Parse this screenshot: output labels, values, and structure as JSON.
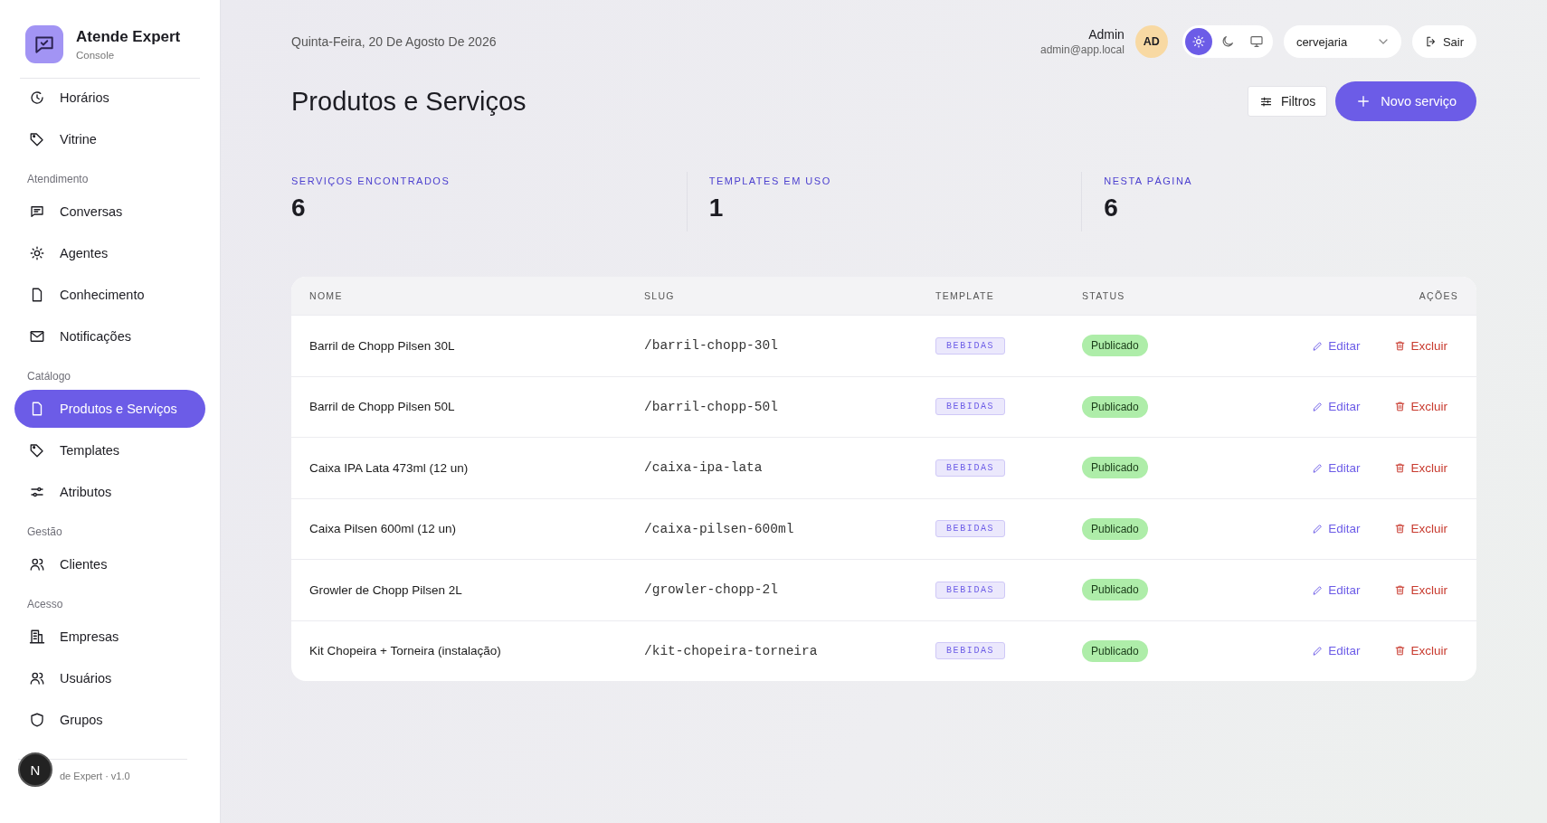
{
  "sidebar": {
    "brand": {
      "title": "Atende Expert",
      "subtitle": "Console"
    },
    "sections": [
      {
        "items": [
          {
            "label": "Horários",
            "selected": false
          },
          {
            "label": "Vitrine",
            "selected": false
          }
        ]
      },
      {
        "title": "Atendimento",
        "items": [
          {
            "label": "Conversas",
            "selected": false
          },
          {
            "label": "Agentes",
            "selected": false
          },
          {
            "label": "Conhecimento",
            "selected": false
          },
          {
            "label": "Notificações",
            "selected": false
          }
        ]
      },
      {
        "title": "Catálogo",
        "items": [
          {
            "label": "Produtos e Serviços",
            "selected": true
          },
          {
            "label": "Templates",
            "selected": false
          },
          {
            "label": "Atributos",
            "selected": false
          }
        ]
      },
      {
        "title": "Gestão",
        "items": [
          {
            "label": "Clientes",
            "selected": false
          }
        ]
      },
      {
        "title": "Acesso",
        "items": [
          {
            "label": "Empresas",
            "selected": false
          },
          {
            "label": "Usuários",
            "selected": false
          },
          {
            "label": "Grupos",
            "selected": false
          }
        ]
      }
    ],
    "footer": "de Expert · v1.0",
    "dev_badge": "N"
  },
  "header": {
    "date": "Quinta-Feira, 20 De Agosto De 2026",
    "user": {
      "name": "Admin",
      "email": "admin@app.local",
      "initials": "AD"
    },
    "theme_options": [
      {
        "selected": true
      },
      {
        "selected": false
      },
      {
        "selected": false
      }
    ],
    "company_select": {
      "value": "cervejaria"
    },
    "logout": "Sair"
  },
  "page": {
    "title": "Produtos e Serviços",
    "filter_button": "Filtros",
    "new_button": "Novo serviço"
  },
  "stats": [
    {
      "label": "SERVIÇOS ENCONTRADOS",
      "value": "6"
    },
    {
      "label": "TEMPLATES EM USO",
      "value": "1"
    },
    {
      "label": "NESTA PÁGINA",
      "value": "6"
    }
  ],
  "table": {
    "columns": [
      "NOME",
      "SLUG",
      "TEMPLATE",
      "STATUS",
      "AÇÕES"
    ],
    "rows": [
      {
        "name": "Barril de Chopp Pilsen 30L",
        "slug": "/barril-chopp-30l",
        "template": "BEBIDAS",
        "status": "Publicado",
        "edit": "Editar",
        "delete": "Excluir"
      },
      {
        "name": "Barril de Chopp Pilsen 50L",
        "slug": "/barril-chopp-50l",
        "template": "BEBIDAS",
        "status": "Publicado",
        "edit": "Editar",
        "delete": "Excluir"
      },
      {
        "name": "Caixa IPA Lata 473ml (12 un)",
        "slug": "/caixa-ipa-lata",
        "template": "BEBIDAS",
        "status": "Publicado",
        "edit": "Editar",
        "delete": "Excluir"
      },
      {
        "name": "Caixa Pilsen 600ml (12 un)",
        "slug": "/caixa-pilsen-600ml",
        "template": "BEBIDAS",
        "status": "Publicado",
        "edit": "Editar",
        "delete": "Excluir"
      },
      {
        "name": "Growler de Chopp Pilsen 2L",
        "slug": "/growler-chopp-2l",
        "template": "BEBIDAS",
        "status": "Publicado",
        "edit": "Editar",
        "delete": "Excluir"
      },
      {
        "name": "Kit Chopeira + Torneira (instalação)",
        "slug": "/kit-chopeira-torneira",
        "template": "BEBIDAS",
        "status": "Publicado",
        "edit": "Editar",
        "delete": "Excluir"
      }
    ]
  }
}
